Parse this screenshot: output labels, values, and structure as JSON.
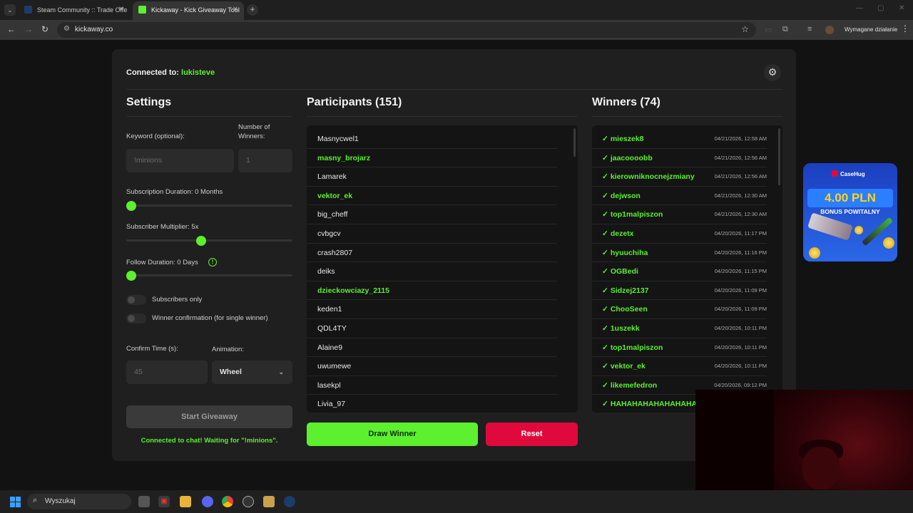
{
  "browser": {
    "tabs": [
      {
        "title": "Steam Community :: Trade Offe",
        "active": false
      },
      {
        "title": "Kickaway - Kick Giveaway Tool",
        "active": true
      }
    ],
    "url": "kickaway.co",
    "action_required": "Wymagane działanie"
  },
  "app": {
    "connected_prefix": "Connected to:",
    "connected_user": "lukisteve",
    "settings": {
      "title": "Settings",
      "keyword_label": "Keyword (optional):",
      "keyword_placeholder": "!minions",
      "winners_label": "Number of Winners:",
      "winners_placeholder": "1",
      "sub_duration_label": "Subscription Duration: 0 Months",
      "sub_duration_value": 0,
      "multiplier_label": "Subscriber Multiplier: 5x",
      "multiplier_value": 5,
      "follow_label": "Follow Duration:  0  Days",
      "follow_value": 0,
      "subscribers_only_label": "Subscribers only",
      "subscribers_only": false,
      "winner_confirm_label": "Winner confirmation (for single winner)",
      "winner_confirm": false,
      "confirm_time_label": "Confirm Time (s):",
      "confirm_time_placeholder": "45",
      "animation_label": "Animation:",
      "animation_value": "Wheel",
      "start_button": "Start Giveaway",
      "status": "Connected to chat! Waiting for \"!minions\"."
    },
    "participants": {
      "title": "Participants (151)",
      "items": [
        {
          "name": "Masnycwel1",
          "subscriber": false
        },
        {
          "name": "masny_brojarz",
          "subscriber": true
        },
        {
          "name": "Lamarek",
          "subscriber": false
        },
        {
          "name": "vektor_ek",
          "subscriber": true
        },
        {
          "name": "big_cheff",
          "subscriber": false
        },
        {
          "name": "cvbgcv",
          "subscriber": false
        },
        {
          "name": "crash2807",
          "subscriber": false
        },
        {
          "name": "deiks",
          "subscriber": false
        },
        {
          "name": "dzieckowciazy_2115",
          "subscriber": true
        },
        {
          "name": "keden1",
          "subscriber": false
        },
        {
          "name": "QDL4TY",
          "subscriber": false
        },
        {
          "name": "Alaine9",
          "subscriber": false
        },
        {
          "name": "uwumewe",
          "subscriber": false
        },
        {
          "name": "lasekpl",
          "subscriber": false
        },
        {
          "name": "Livia_97",
          "subscriber": false
        }
      ],
      "draw_button": "Draw Winner",
      "reset_button": "Reset"
    },
    "winners": {
      "title": "Winners (74)",
      "check": "✓",
      "items": [
        {
          "name": "mieszek8",
          "time": "04/21/2026, 12:58 AM"
        },
        {
          "name": "jaacoooobb",
          "time": "04/21/2026, 12:56 AM"
        },
        {
          "name": "kierowniknocnejzmiany",
          "time": "04/21/2026, 12:56 AM"
        },
        {
          "name": "dejwson",
          "time": "04/21/2026, 12:30 AM"
        },
        {
          "name": "top1malpiszon",
          "time": "04/21/2026, 12:30 AM"
        },
        {
          "name": "dezetx",
          "time": "04/20/2026, 11:17 PM"
        },
        {
          "name": "hyuuchiha",
          "time": "04/20/2026, 11:16 PM"
        },
        {
          "name": "OGBedi",
          "time": "04/20/2026, 11:15 PM"
        },
        {
          "name": "Sidzej2137",
          "time": "04/20/2026, 11:09 PM"
        },
        {
          "name": "ChooSeen",
          "time": "04/20/2026, 11:09 PM"
        },
        {
          "name": "1uszekk",
          "time": "04/20/2026, 10:11 PM"
        },
        {
          "name": "top1malpiszon",
          "time": "04/20/2026, 10:11 PM"
        },
        {
          "name": "vektor_ek",
          "time": "04/20/2026, 10:11 PM"
        },
        {
          "name": "likemefedron",
          "time": "04/20/2026, 09:12 PM"
        },
        {
          "name": "HAHAHAHAHAHAHAHAHA",
          "time": ""
        }
      ]
    }
  },
  "ad": {
    "brand": "CaseHug",
    "amount": "4.00 PLN",
    "bonus": "BONUS POWITALNY"
  },
  "taskbar": {
    "search_placeholder": "Wyszukaj"
  },
  "colors": {
    "accent": "#5cf02e",
    "danger": "#e0093c",
    "card": "#1f1f1f",
    "background": "#121212"
  }
}
